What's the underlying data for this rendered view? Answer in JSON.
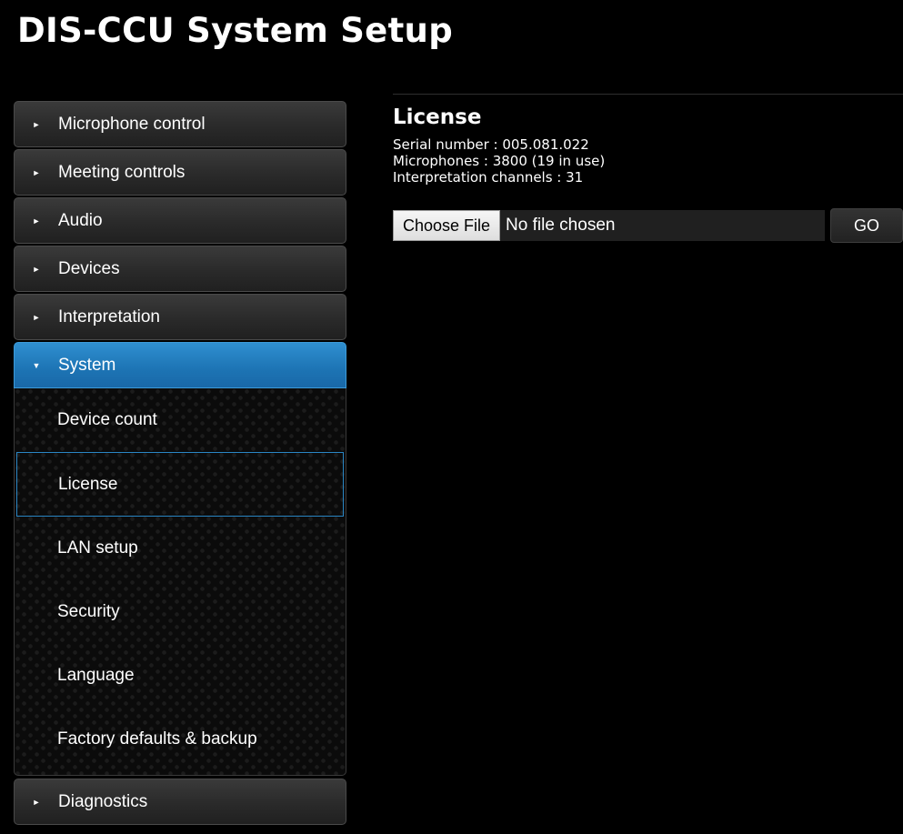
{
  "app": {
    "title": "DIS-CCU System Setup"
  },
  "sidebar": {
    "items_before": [
      {
        "label": "Microphone control",
        "icon": "caret-right-icon"
      },
      {
        "label": "Meeting controls",
        "icon": "caret-right-icon"
      },
      {
        "label": "Audio",
        "icon": "caret-right-icon"
      },
      {
        "label": "Devices",
        "icon": "caret-right-icon"
      },
      {
        "label": "Interpretation",
        "icon": "caret-right-icon"
      }
    ],
    "active": {
      "label": "System",
      "icon": "caret-down-icon"
    },
    "submenu": [
      {
        "label": "Device count"
      },
      {
        "label": "License",
        "selected": true
      },
      {
        "label": "LAN setup"
      },
      {
        "label": "Security"
      },
      {
        "label": "Language"
      },
      {
        "label": "Factory defaults & backup"
      }
    ],
    "items_after": [
      {
        "label": "Diagnostics",
        "icon": "caret-right-icon"
      }
    ]
  },
  "main": {
    "title": "License",
    "serial_line": "Serial number : 005.081.022",
    "microphones_line": "Microphones : 3800 (19 in use)",
    "channels_line": "Interpretation channels : 31",
    "file": {
      "button_label": "Choose File",
      "status": "No file chosen"
    },
    "go_label": "GO"
  },
  "colors": {
    "background": "#000000",
    "active_nav": "#1d74b4",
    "selected_border": "#2a86c4"
  }
}
